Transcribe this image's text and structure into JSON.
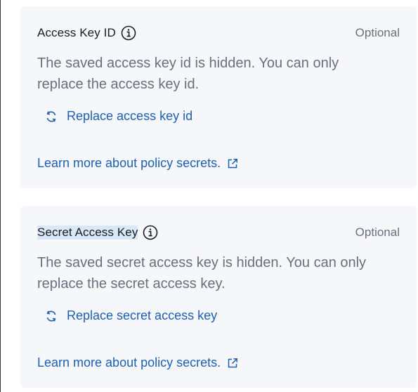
{
  "access_key_id": {
    "title": "Access Key ID",
    "optional_label": "Optional",
    "help_text": "The saved access key id is hidden. You can only replace the access key id.",
    "replace_label": "Replace access key id",
    "learn_more_label": "Learn more about policy secrets."
  },
  "secret_access_key": {
    "title": "Secret Access Key",
    "optional_label": "Optional",
    "help_text": "The saved secret access key is hidden. You can only replace the secret access key.",
    "replace_label": "Replace secret access key",
    "learn_more_label": "Learn more about policy secrets."
  },
  "icons": {
    "info": "info-icon",
    "refresh": "refresh-icon",
    "external_link": "external-link-icon"
  },
  "colors": {
    "link": "#1e5fb3",
    "panel_bg": "#f5f7fa",
    "subdued_text": "#69707d",
    "title_text": "#1a1c21",
    "highlight": "#d9e8f8"
  }
}
